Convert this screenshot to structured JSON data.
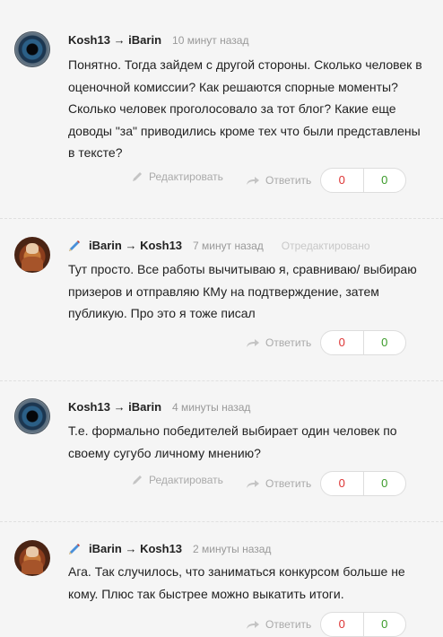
{
  "comments": [
    {
      "author": "Kosh13 → iBarin",
      "time": "10 минут назад",
      "text": "Понятно. Тогда зайдем с другой стороны. Сколько человек в оценочной комиссии? Как решаются спорные моменты? Сколько человек проголосовало за тот блог? Какие еще доводы \"за\" приводились кроме тех что были представлены в тексте?",
      "edit_label": "Редактировать",
      "reply_label": "Ответить",
      "votes_down": "0",
      "votes_up": "0"
    },
    {
      "author": "iBarin → Kosh13",
      "time": "7 минут назад",
      "edited": "Отредактировано",
      "text": "Тут просто. Все работы вычитываю я, сравниваю/ выбираю призеров и отправляю КМу на подтверждение, затем публикую. Про это я тоже писал",
      "reply_label": "Ответить",
      "votes_down": "0",
      "votes_up": "0"
    },
    {
      "author": "Kosh13 → iBarin",
      "time": "4 минуты назад",
      "text": "Т.е. формально победителей выбирает один человек по своему сугубо личному мнению?",
      "edit_label": "Редактировать",
      "reply_label": "Ответить",
      "votes_down": "0",
      "votes_up": "0"
    },
    {
      "author": "iBarin → Kosh13",
      "time": "2 минуты назад",
      "text": "Ага. Так случилось, что заниматься конкурсом больше не кому. Плюс так быстрее можно выкатить итоги.",
      "reply_label": "Ответить",
      "votes_down": "0",
      "votes_up": "0"
    }
  ],
  "colors": {
    "background": "#f5f5f5",
    "vote_down": "#dd3333",
    "vote_up": "#3a9a28",
    "muted": "#aaaaaa"
  }
}
